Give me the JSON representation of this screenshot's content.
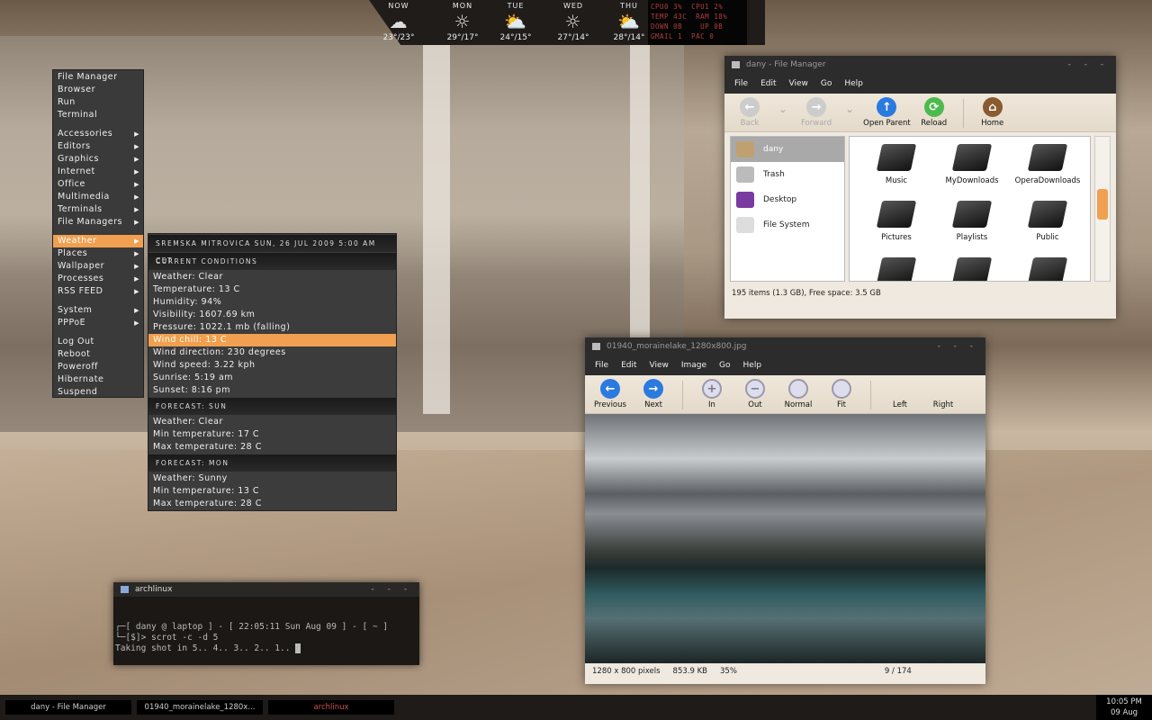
{
  "colors": {
    "accent": "#f0a050",
    "sysmon_text": "#b33c3c",
    "panel": "#1f1c1a"
  },
  "weather_bar": {
    "days": [
      {
        "label": "NOW",
        "temp": "23°/23°",
        "icon": "partly-cloudy-night-icon"
      },
      {
        "label": "MON",
        "temp": "29°/17°",
        "icon": "sunny-icon"
      },
      {
        "label": "TUE",
        "temp": "24°/15°",
        "icon": "partly-cloudy-icon"
      },
      {
        "label": "WED",
        "temp": "27°/14°",
        "icon": "sunny-icon"
      },
      {
        "label": "THU",
        "temp": "28°/14°",
        "icon": "partly-cloudy-icon"
      }
    ]
  },
  "sysmon": {
    "lines": [
      "CPU0 3%  CPU1 2%",
      "TEMP 43C  RAM 18%",
      "DOWN 0B    UP 0B",
      "GMAIL 1  PAC 0"
    ]
  },
  "menu": {
    "groups": [
      [
        {
          "label": "File Manager"
        },
        {
          "label": "Browser"
        },
        {
          "label": "Run"
        },
        {
          "label": "Terminal"
        }
      ],
      [
        {
          "label": "Accessories",
          "sub": true
        },
        {
          "label": "Editors",
          "sub": true
        },
        {
          "label": "Graphics",
          "sub": true
        },
        {
          "label": "Internet",
          "sub": true
        },
        {
          "label": "Office",
          "sub": true
        },
        {
          "label": "Multimedia",
          "sub": true
        },
        {
          "label": "Terminals",
          "sub": true
        },
        {
          "label": "File Managers",
          "sub": true
        }
      ],
      [
        {
          "label": "Weather",
          "sub": true,
          "selected": true
        },
        {
          "label": "Places",
          "sub": true
        },
        {
          "label": "Wallpaper",
          "sub": true
        },
        {
          "label": "Processes",
          "sub": true
        },
        {
          "label": "RSS FEED",
          "sub": true
        }
      ],
      [
        {
          "label": "System",
          "sub": true
        },
        {
          "label": "PPPoE",
          "sub": true
        }
      ],
      [
        {
          "label": "Log Out"
        },
        {
          "label": "Reboot"
        },
        {
          "label": "Poweroff"
        },
        {
          "label": "Hibernate"
        },
        {
          "label": "Suspend"
        }
      ]
    ]
  },
  "weather_menu": {
    "header": "SREMSKA MITROVICA SUN, 26 JUL 2009 5:00 AM CET",
    "sections": [
      {
        "title": "CURRENT CONDITIONS",
        "lines": [
          "Weather: Clear",
          "Temperature: 13 C",
          "Humidity: 94%",
          "Visibility: 1607.69 km",
          "Pressure: 1022.1 mb (falling)",
          "Wind chill: 13 C",
          "Wind direction: 230 degrees",
          "Wind speed: 3.22 kph",
          "Sunrise: 5:19 am",
          "Sunset: 8:16 pm"
        ],
        "selected": 5
      },
      {
        "title": "FORECAST: SUN",
        "lines": [
          "Weather: Clear",
          "Min temperature: 17 C",
          "Max temperature: 28 C"
        ]
      },
      {
        "title": "FORECAST: MON",
        "lines": [
          "Weather: Sunny",
          "Min temperature: 13 C",
          "Max temperature: 28 C"
        ]
      }
    ]
  },
  "file_manager": {
    "title": "dany - File Manager",
    "menu": [
      "File",
      "Edit",
      "View",
      "Go",
      "Help"
    ],
    "toolbar": [
      {
        "label": "Back",
        "disabled": true
      },
      {
        "label": "Forward",
        "disabled": true
      },
      {
        "label": "Open Parent"
      },
      {
        "label": "Reload"
      },
      {
        "label": "Home"
      }
    ],
    "places": [
      {
        "label": "dany",
        "selected": true
      },
      {
        "label": "Trash"
      },
      {
        "label": "Desktop"
      },
      {
        "label": "File System"
      }
    ],
    "files": [
      "Music",
      "MyDownloads",
      "OperaDownloads",
      "Pictures",
      "Playlists",
      "Public",
      "",
      "",
      ""
    ],
    "status": "195 items (1.3 GB), Free space: 3.5 GB"
  },
  "image_viewer": {
    "title": "01940_morainelake_1280x800.jpg",
    "menu": [
      "File",
      "Edit",
      "View",
      "Image",
      "Go",
      "Help"
    ],
    "toolbar": [
      "Previous",
      "Next",
      "In",
      "Out",
      "Normal",
      "Fit",
      "Left",
      "Right"
    ],
    "status": {
      "dimensions": "1280 x 800 pixels",
      "size": "853.9 KB",
      "zoom": "35%",
      "position": "9 / 174"
    }
  },
  "terminal": {
    "title": "archlinux",
    "lines": [
      "┌─[ dany @ laptop ] - [ 22:05:11 Sun Aug 09 ] - [ ~ ]",
      "└─[$]> scrot -c -d 5",
      "Taking shot in 5.. 4.. 3.. 2.. 1.. "
    ]
  },
  "taskbar": {
    "tasks": [
      "dany - File Manager",
      "01940_morainelake_1280x...",
      "archlinux"
    ],
    "time": "10:05 PM",
    "date": "09 Aug"
  }
}
